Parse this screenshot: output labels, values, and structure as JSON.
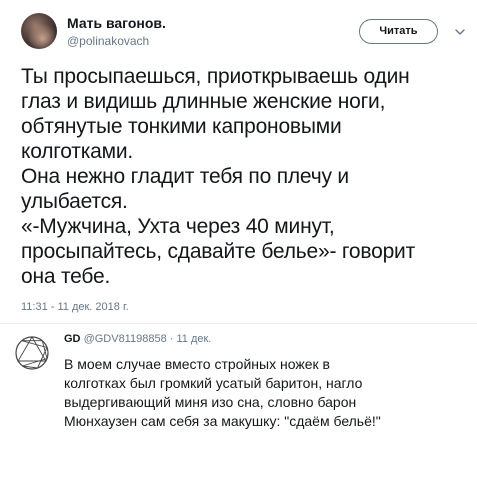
{
  "tweet": {
    "author_name": "Мать вагонов.",
    "author_handle": "@polinakovach",
    "follow_label": "Читать",
    "text_lines": [
      "Ты просыпаешься, приоткрываешь один",
      "глаз и видишь длинные женские ноги,",
      "обтянутые тонкими капроновыми",
      "колготками.",
      "Она нежно гладит тебя по плечу и",
      "улыбается.",
      "«-Мужчина, Ухта через 40 минут,",
      "просыпайтесь, сдавайте белье»- говорит",
      "она тебе."
    ],
    "timestamp": "11:31 - 11 дек. 2018 г."
  },
  "reply": {
    "name": "GD",
    "handle": "@GDV81198858",
    "date": "· 11 дек.",
    "text_lines": [
      "В моем случае вместо стройных ножек в",
      "колготках был громкий усатый баритон, нагло",
      "выдергивающий миня изо сна, словно барон",
      "Мюнхаузен сам себя за макушку: \"сдаём бельё!\""
    ]
  },
  "icons": {
    "caret": "chevron-down-icon",
    "reply_avatar": "enneagram-icon"
  }
}
